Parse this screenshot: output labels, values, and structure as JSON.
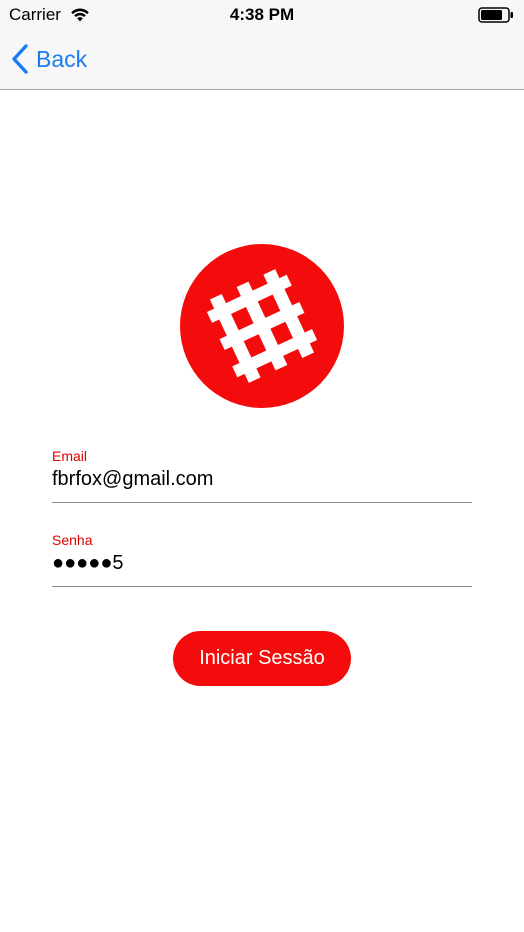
{
  "status_bar": {
    "carrier": "Carrier",
    "time": "4:38 PM",
    "wifi_icon": "wifi-icon",
    "battery_icon": "battery-icon"
  },
  "nav_bar": {
    "back_label": "Back",
    "back_icon": "chevron-left-icon"
  },
  "logo": {
    "icon": "ladder-icon",
    "background_color": "#f40b0b",
    "glyph_color": "#ffffff"
  },
  "form": {
    "email": {
      "label": "Email",
      "value": "fbrfox@gmail.com"
    },
    "password": {
      "label": "Senha",
      "value": "●●●●●5"
    },
    "submit_label": "Iniciar Sessão"
  },
  "colors": {
    "accent": "#f40b0b",
    "label": "#e10000",
    "link": "#1a7cf5"
  }
}
